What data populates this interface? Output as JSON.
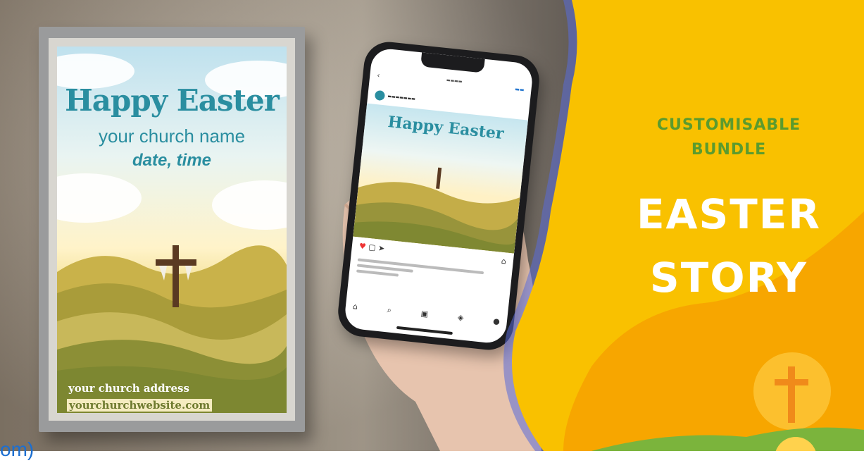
{
  "poster": {
    "title": "Happy Easter",
    "church_name": "your church name",
    "date_time": "date, time",
    "address": "your church address",
    "website": "yourchurchwebsite.com"
  },
  "phone_post": {
    "title": "Happy Easter"
  },
  "banner": {
    "line1": "CUSTOMISABLE",
    "line2": "BUNDLE",
    "line3": "EASTER",
    "line4": "STORY"
  },
  "corner_text": "om)",
  "colors": {
    "banner_yellow": "#f9c100",
    "banner_orange": "#f7a600",
    "accent_green": "#5b9b2e",
    "poster_teal": "#2a8ea0",
    "link_blue": "#1c6fd1"
  }
}
